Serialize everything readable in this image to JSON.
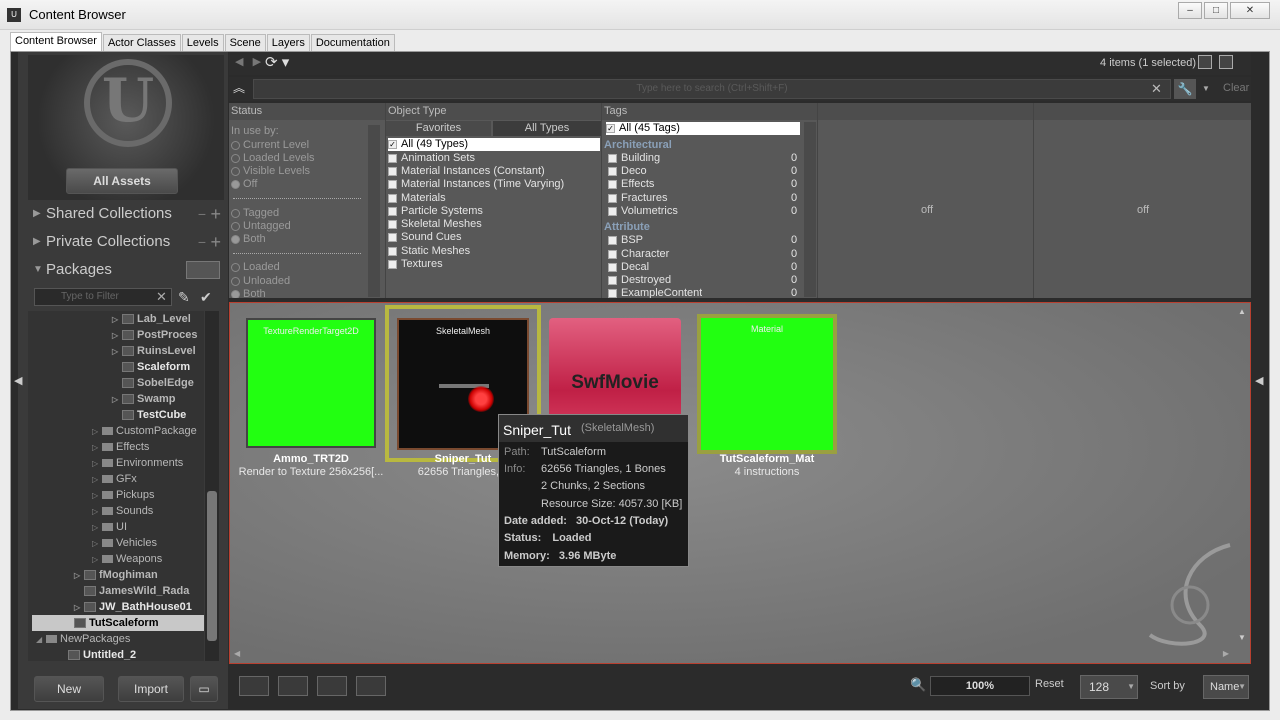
{
  "window": {
    "title": "Content Browser",
    "controls": [
      "–",
      "□",
      "✕"
    ]
  },
  "tabs": [
    "Content Browser",
    "Actor Classes",
    "Levels",
    "Scene",
    "Layers",
    "Documentation"
  ],
  "left": {
    "all_assets": "All Assets",
    "shared_collections": "Shared Collections",
    "private_collections": "Private Collections",
    "packages": "Packages",
    "filter_placeholder": "Type to Filter",
    "tree": [
      {
        "label": "Lab_Level",
        "bold": true
      },
      {
        "label": "PostProces",
        "bold": true
      },
      {
        "label": "RuinsLevel",
        "bold": true
      },
      {
        "label": "Scaleform",
        "bold": true,
        "white": true
      },
      {
        "label": "SobelEdge",
        "bold": true
      },
      {
        "label": "Swamp",
        "bold": true
      },
      {
        "label": "TestCube",
        "bold": true,
        "white": true
      },
      {
        "label": "CustomPackage"
      },
      {
        "label": "Effects"
      },
      {
        "label": "Environments"
      },
      {
        "label": "GFx"
      },
      {
        "label": "Pickups"
      },
      {
        "label": "Sounds"
      },
      {
        "label": "UI"
      },
      {
        "label": "Vehicles"
      },
      {
        "label": "Weapons"
      },
      {
        "label": "fMoghiman",
        "bold": true
      },
      {
        "label": "JamesWild_Rada",
        "bold": true
      },
      {
        "label": "JW_BathHouse01",
        "bold": true,
        "white": true
      },
      {
        "label": "TutScaleform",
        "bold": true,
        "selected": true
      },
      {
        "label": "NewPackages"
      },
      {
        "label": "Untitled_2",
        "bold": true,
        "white": true
      }
    ],
    "buttons": {
      "new": "New",
      "import": "Import"
    }
  },
  "toolbar": {
    "item_count": "4 items (1 selected)"
  },
  "search": {
    "placeholder": "Type here to search   (Ctrl+Shift+F)",
    "clear": "Clear"
  },
  "filters": {
    "status": {
      "header": "Status",
      "in_use_by": "In use by:",
      "options_a": [
        "Current Level",
        "Loaded Levels",
        "Visible Levels",
        "Off"
      ],
      "options_b": [
        "Tagged",
        "Untagged",
        "Both"
      ],
      "options_c": [
        "Loaded",
        "Unloaded",
        "Both"
      ]
    },
    "object_type": {
      "header": "Object Type",
      "tab_favorites": "Favorites",
      "tab_all": "All Types",
      "items": [
        "All (49 Types)",
        "Animation Sets",
        "Material Instances (Constant)",
        "Material Instances (Time Varying)",
        "Materials",
        "Particle Systems",
        "Skeletal Meshes",
        "Sound Cues",
        "Static Meshes",
        "Textures"
      ]
    },
    "tags": {
      "header": "Tags",
      "all": "All (45 Tags)",
      "cat_arch": "Architectural",
      "arch": [
        {
          "label": "Building",
          "count": "0"
        },
        {
          "label": "Deco",
          "count": "0"
        },
        {
          "label": "Effects",
          "count": "0"
        },
        {
          "label": "Fractures",
          "count": "0"
        },
        {
          "label": "Volumetrics",
          "count": "0"
        }
      ],
      "cat_attr": "Attribute",
      "attr": [
        {
          "label": "BSP",
          "count": "0"
        },
        {
          "label": "Character",
          "count": "0"
        },
        {
          "label": "Decal",
          "count": "0"
        },
        {
          "label": "Destroyed",
          "count": "0"
        },
        {
          "label": "ExampleContent",
          "count": "0"
        }
      ]
    },
    "off_1": "off",
    "off_2": "off"
  },
  "assets": [
    {
      "type": "TextureRenderTarget2D",
      "name": "Ammo_TRT2D",
      "desc": "Render to Texture 256x256[...",
      "color": "#22ff11"
    },
    {
      "type": "SkeletalMesh",
      "name": "Sniper_Tut",
      "desc": "62656 Triangles, 1",
      "color": "#111111"
    },
    {
      "type": "",
      "name": "",
      "desc": "",
      "thumb_text": "SwfMovie",
      "color": "#d8385a"
    },
    {
      "type": "Material",
      "name": "TutScaleform_Mat",
      "desc": "4 instructions",
      "color": "#22ff11"
    }
  ],
  "tooltip": {
    "title": "Sniper_Tut",
    "type": "(SkeletalMesh)",
    "path_label": "Path:",
    "path": "TutScaleform",
    "info_label": "Info:",
    "info1": "62656 Triangles, 1 Bones",
    "info2": "2 Chunks, 2 Sections",
    "info3": "Resource Size: 4057.30 [KB]",
    "date_label": "Date added:",
    "date": "30-Oct-12 (Today)",
    "status_label": "Status:",
    "status": "Loaded",
    "memory_label": "Memory:",
    "memory": "3.96 MByte"
  },
  "bottom": {
    "zoom": "100%",
    "reset": "Reset",
    "size": "128",
    "sort_by": "Sort by",
    "sort": "Name"
  },
  "colors": {
    "selection": "#b8b840",
    "assetview_border": "#b84030"
  }
}
